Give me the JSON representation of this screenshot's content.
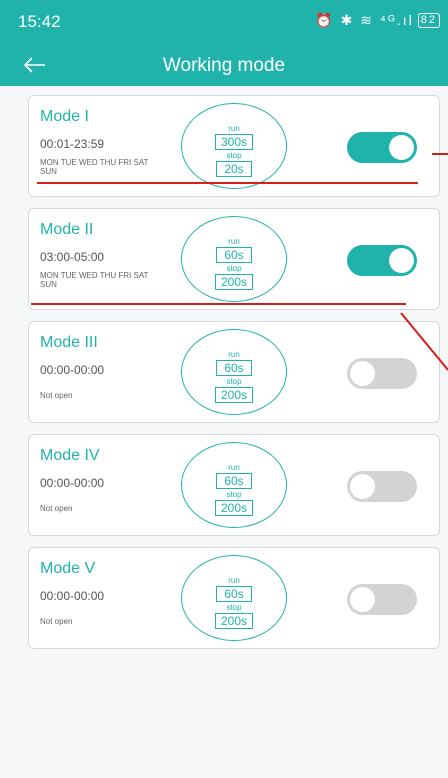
{
  "status_bar": {
    "time": "15:42",
    "icons": "⏰ ✱ ≋ ⁴ᴳ.ıl",
    "battery": "82"
  },
  "nav": {
    "title": "Working mode",
    "back_icon": "arrow-left-icon"
  },
  "colors": {
    "accent": "#1fb3ab",
    "annotation": "#d91c1c",
    "toggle_off": "#d3d3d3"
  },
  "modes": [
    {
      "name": "Mode I",
      "time": "00:01-23:59",
      "days": "MON TUE WED THU FRI SAT SUN",
      "run_label": "run",
      "run": "300s",
      "stop_label": "stop",
      "stop": "20s",
      "enabled": true
    },
    {
      "name": "Mode II",
      "time": "03:00-05:00",
      "days": "MON TUE WED THU FRI SAT SUN",
      "run_label": "run",
      "run": "60s",
      "stop_label": "stop",
      "stop": "200s",
      "enabled": true
    },
    {
      "name": "Mode III",
      "time": "00:00-00:00",
      "days": "Not open",
      "run_label": "run",
      "run": "60s",
      "stop_label": "stop",
      "stop": "200s",
      "enabled": false
    },
    {
      "name": "Mode IV",
      "time": "00:00-00:00",
      "days": "Not open",
      "run_label": "run",
      "run": "60s",
      "stop_label": "stop",
      "stop": "200s",
      "enabled": false
    },
    {
      "name": "Mode V",
      "time": "00:00-00:00",
      "days": "Not open",
      "run_label": "run",
      "run": "60s",
      "stop_label": "stop",
      "stop": "200s",
      "enabled": false
    }
  ]
}
